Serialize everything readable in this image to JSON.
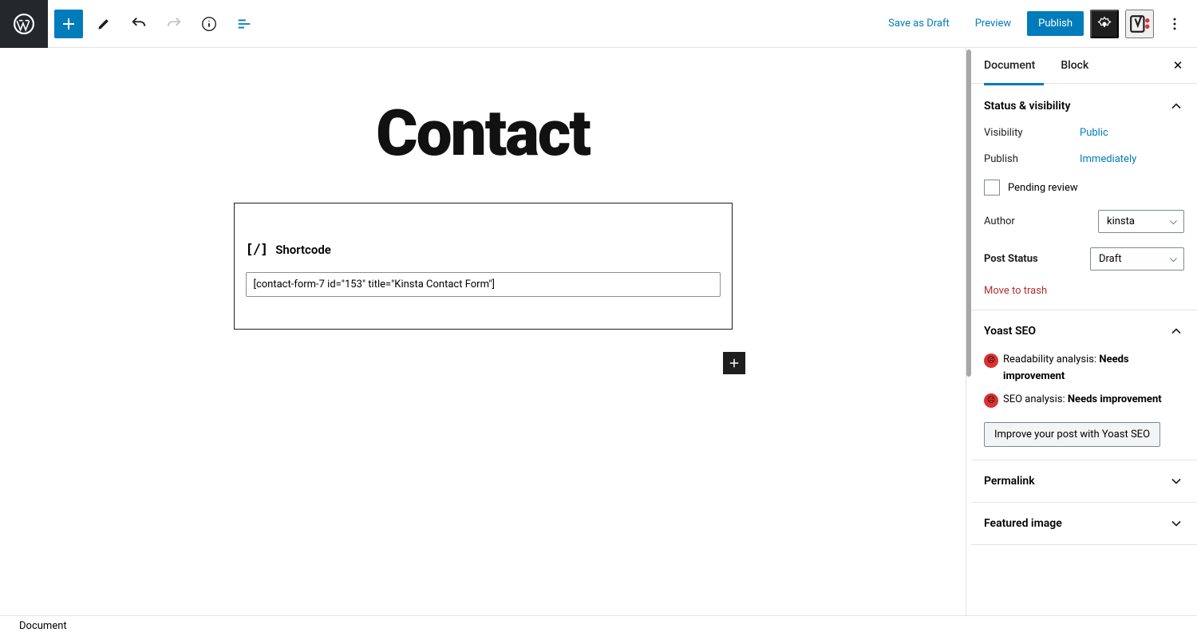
{
  "header": {
    "save_label": "Save as Draft",
    "preview_label": "Preview",
    "publish_label": "Publish"
  },
  "editor": {
    "title": "Contact",
    "block_label": "Shortcode",
    "shortcode_value": "[contact-form-7 id=\"153\" title=\"Kinsta Contact Form\"]"
  },
  "sidebar": {
    "tabs": {
      "document": "Document",
      "block": "Block"
    },
    "status": {
      "title": "Status & visibility",
      "visibility_label": "Visibility",
      "visibility_value": "Public",
      "publish_label": "Publish",
      "publish_value": "Immediately",
      "pending_label": "Pending review",
      "author_label": "Author",
      "author_value": "kinsta",
      "post_status_label": "Post Status",
      "post_status_value": "Draft",
      "trash_label": "Move to trash"
    },
    "yoast": {
      "title": "Yoast SEO",
      "readability_prefix": "Readability analysis: ",
      "readability_status": "Needs improvement",
      "seo_prefix": "SEO analysis: ",
      "seo_status": "Needs improvement",
      "improve_btn": "Improve your post with Yoast SEO"
    },
    "permalink_title": "Permalink",
    "featured_title": "Featured image"
  },
  "footer": {
    "breadcrumb": "Document"
  }
}
